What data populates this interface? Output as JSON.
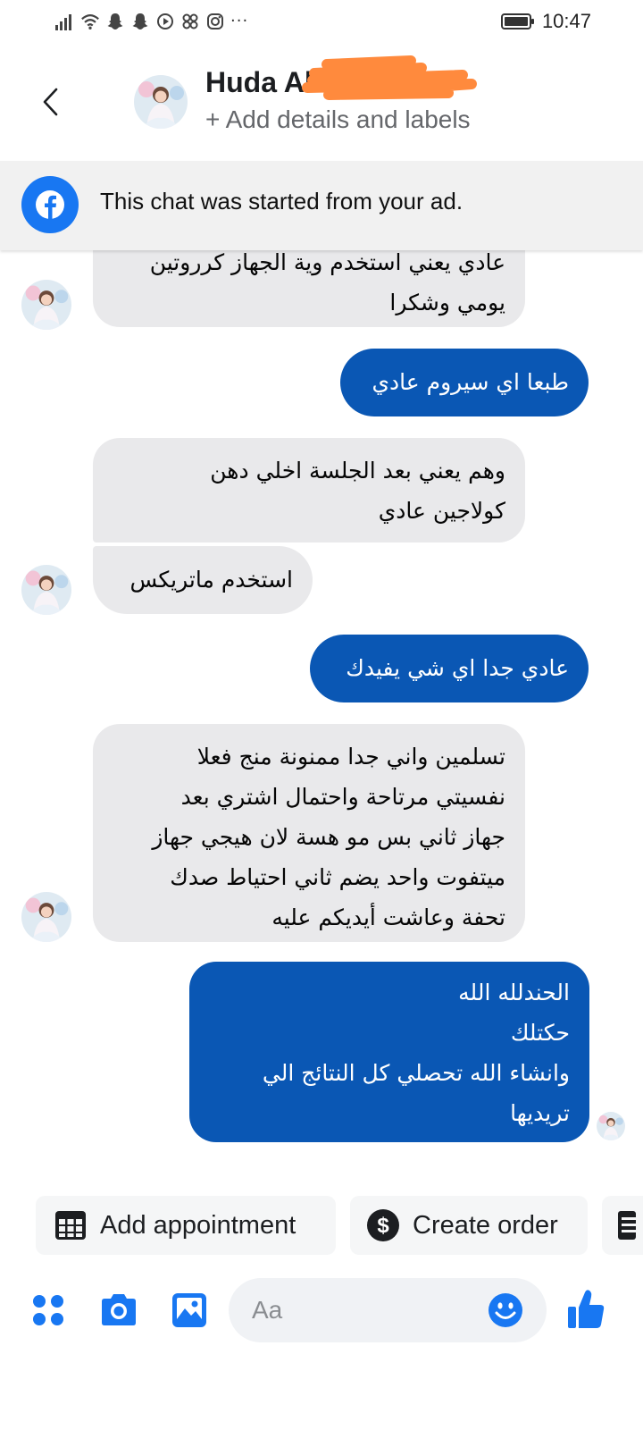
{
  "status_bar": {
    "time": "10:47",
    "icons": [
      "signal-icon",
      "wifi-icon",
      "snapchat-icon",
      "snapchat-icon",
      "media-icon",
      "app-icon",
      "instagram-icon",
      "more-dots-icon"
    ],
    "more": "···"
  },
  "header": {
    "contact_name": "Huda Al",
    "add_details": "+ Add details and labels"
  },
  "banner": {
    "text": "This chat was started from your ad.",
    "icon": "facebook-icon"
  },
  "messages": [
    {
      "direction": "incoming",
      "text": "عادي يعني استخدم وية الجهاز كرروتين\nيومي وشكرا"
    },
    {
      "direction": "outgoing",
      "text": "طبعا اي سيروم عادي"
    },
    {
      "direction": "incoming",
      "text": "وهم يعني بعد الجلسة اخلي دهن\nكولاجين عادي"
    },
    {
      "direction": "incoming",
      "text": "استخدم ماتريكس"
    },
    {
      "direction": "outgoing",
      "text": "عادي جدا اي شي يفيدك"
    },
    {
      "direction": "incoming",
      "text": "تسلمين واني جدا ممنونة  منج فعلا\nنفسيتي مرتاحة واحتمال اشتري بعد\nجهاز ثاني بس مو هسة لان هيجي جهاز\nميتفوت واحد يضم ثاني احتياط صدك\nتحفة وعاشت أيديكم عليه"
    },
    {
      "direction": "outgoing",
      "text": "الحندلله الله\nحكتلك\nوانشاء الله تحصلي كل النتائج الي\nتريديها"
    }
  ],
  "quick_actions": {
    "add_appointment": "Add appointment",
    "create_order": "Create order"
  },
  "composer": {
    "placeholder": "Aa"
  },
  "colors": {
    "outgoing_bubble": "#0a57b4",
    "incoming_bubble": "#e9e9eb",
    "accent": "#1877f2",
    "redaction": "#ff8a3d"
  }
}
